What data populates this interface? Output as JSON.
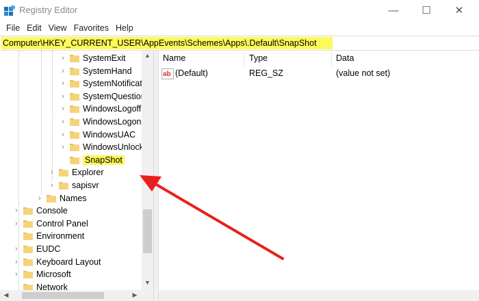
{
  "window": {
    "title": "Registry Editor",
    "controls": {
      "minimize": "—",
      "maximize": "☐",
      "close": "✕"
    }
  },
  "menu": [
    "File",
    "Edit",
    "View",
    "Favorites",
    "Help"
  ],
  "address": "Computer\\HKEY_CURRENT_USER\\AppEvents\\Schemes\\Apps\\.Default\\SnapShot",
  "tree": {
    "items": [
      {
        "label": "SystemExit",
        "expander": "›"
      },
      {
        "label": "SystemHand",
        "expander": "›"
      },
      {
        "label": "SystemNotificat",
        "expander": "›"
      },
      {
        "label": "SystemQuestion",
        "expander": "›"
      },
      {
        "label": "WindowsLogoff",
        "expander": "›"
      },
      {
        "label": "WindowsLogon",
        "expander": "›"
      },
      {
        "label": "WindowsUAC",
        "expander": "›"
      },
      {
        "label": "WindowsUnlock",
        "expander": "›"
      },
      {
        "label": "SnapShot",
        "expander": ""
      },
      {
        "label": "Explorer",
        "expander": "›"
      },
      {
        "label": "sapisvr",
        "expander": "›"
      },
      {
        "label": "Names",
        "expander": "›"
      },
      {
        "label": "Console",
        "expander": "›"
      },
      {
        "label": "Control Panel",
        "expander": "›"
      },
      {
        "label": "Environment",
        "expander": ""
      },
      {
        "label": "EUDC",
        "expander": "›"
      },
      {
        "label": "Keyboard Layout",
        "expander": "›"
      },
      {
        "label": "Microsoft",
        "expander": "›"
      },
      {
        "label": "Network",
        "expander": ""
      }
    ],
    "selected": "SnapShot"
  },
  "list": {
    "columns": [
      "Name",
      "Type",
      "Data"
    ],
    "rows": [
      {
        "name": "(Default)",
        "type": "REG_SZ",
        "data": "(value not set)",
        "icon": "string-value-icon"
      }
    ]
  },
  "colors": {
    "highlight": "#fcf95a",
    "arrow": "#e8201c",
    "folder": "#e8c25a"
  }
}
